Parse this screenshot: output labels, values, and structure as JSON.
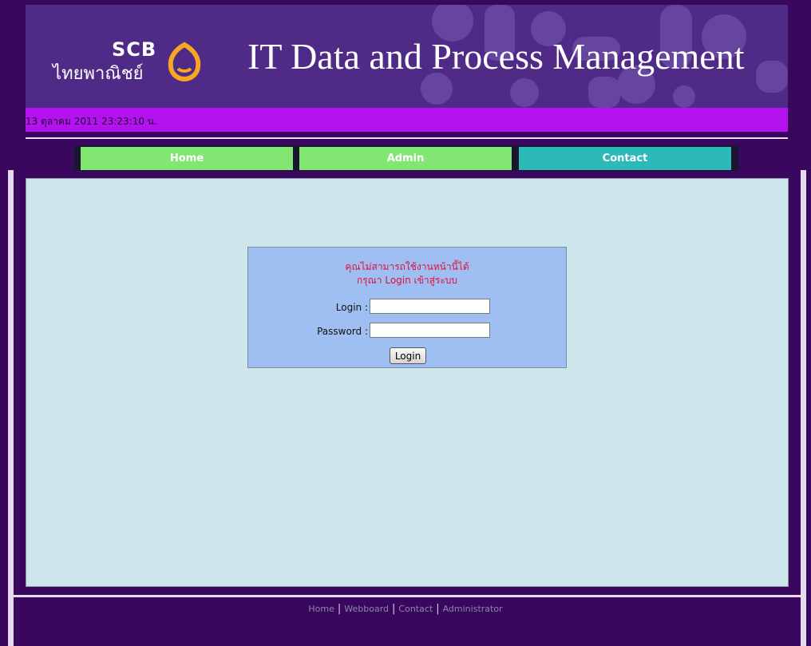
{
  "header": {
    "logo_brand": "SCB",
    "logo_thai": "ไทยพาณิชย์",
    "title": "IT Data and Process Management",
    "accent_color": "#4f2a86"
  },
  "datebar": {
    "datetime": "13 ตุลาคม 2011 23:23:10 น.",
    "color": "#b413ef"
  },
  "nav": {
    "home": "Home",
    "admin": "Admin",
    "contact": "Contact"
  },
  "login": {
    "message_line1": "คุณไม่สามารถใช้งานหน้านี้ได้",
    "message_line2": "กรุณา Login เข้าสู่ระบบ",
    "login_label": "Login :",
    "login_value": "",
    "password_label": "Password :",
    "password_value": "",
    "submit_label": "Login"
  },
  "footer": {
    "links": [
      "Home",
      "Webboard",
      "Contact",
      "Administrator"
    ],
    "separator": "|"
  }
}
